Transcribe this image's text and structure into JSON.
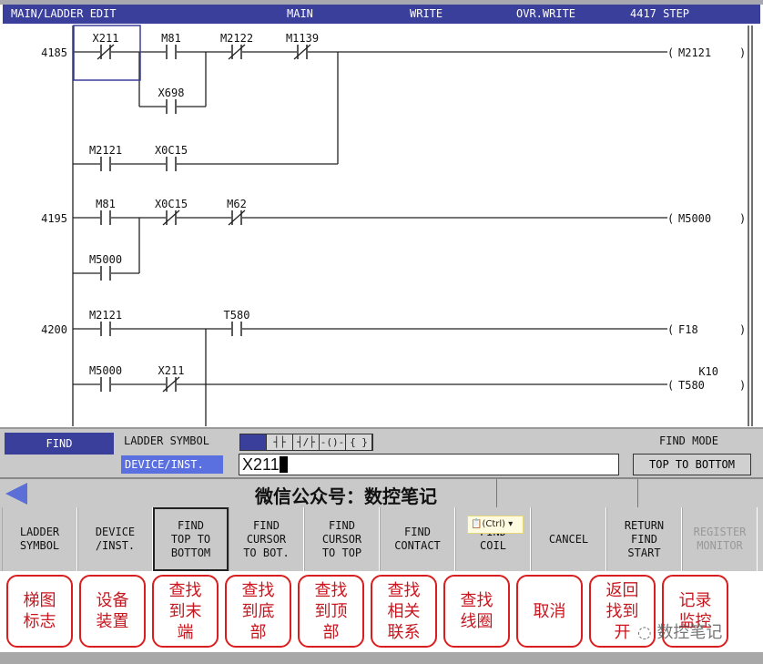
{
  "header": {
    "mode": "MAIN/LADDER EDIT",
    "program": "MAIN",
    "write": "WRITE",
    "overwrite": "OVR.WRITE",
    "steps": "4417 STEP"
  },
  "ladder": {
    "step_numbers": [
      "4185",
      "4195",
      "4200"
    ],
    "contacts": [
      {
        "label": "X211",
        "type": "NC"
      },
      {
        "label": "M81",
        "type": "NO"
      },
      {
        "label": "M2122",
        "type": "NC"
      },
      {
        "label": "M1139",
        "type": "NC"
      },
      {
        "label": "X698",
        "type": "NO"
      },
      {
        "label": "M2121",
        "type": "NO"
      },
      {
        "label": "X0C15",
        "type": "NO"
      },
      {
        "label": "M81",
        "type": "NO"
      },
      {
        "label": "X0C15",
        "type": "NC"
      },
      {
        "label": "M62",
        "type": "NC"
      },
      {
        "label": "M5000",
        "type": "NO"
      },
      {
        "label": "M2121",
        "type": "NO"
      },
      {
        "label": "T580",
        "type": "NO"
      },
      {
        "label": "M5000",
        "type": "NO"
      },
      {
        "label": "X211",
        "type": "NC"
      }
    ],
    "coils": [
      {
        "label": "M2121"
      },
      {
        "label": "M5000"
      },
      {
        "label": "F18"
      },
      {
        "label": "T580",
        "setting": "K10"
      }
    ],
    "cursor_on": "X211"
  },
  "find": {
    "title": "FIND",
    "ladder_symbol_label": "LADDER SYMBOL",
    "device_label": "DEVICE/INST.",
    "symbols": [
      "",
      "┤├",
      "┤/├",
      "-()-",
      "{ }"
    ],
    "input_value": "X211",
    "mode_label": "FIND MODE",
    "mode_value": "TOP TO BOTTOM"
  },
  "message": "微信公众号：数控笔记",
  "softkeys": [
    {
      "label": "LADDER\nSYMBOL"
    },
    {
      "label": "DEVICE\n/INST."
    },
    {
      "label": "FIND\nTOP TO\nBOTTOM",
      "selected": true
    },
    {
      "label": "FIND\nCURSOR\nTO BOT."
    },
    {
      "label": "FIND\nCURSOR\nTO TOP"
    },
    {
      "label": "FIND\nCONTACT"
    },
    {
      "label": "FIND\nCOIL"
    },
    {
      "label": "CANCEL"
    },
    {
      "label": "RETURN\nFIND\nSTART"
    },
    {
      "label": "REGISTER\nMONITOR",
      "disabled": true
    }
  ],
  "paste_tooltip": "(Ctrl) ▾",
  "translations": [
    "梯图\n标志",
    "设备\n装置",
    "查找\n到末\n端",
    "查找\n到底\n部",
    "查找\n到顶\n部",
    "查找\n相关\n联系",
    "查找\n线圈",
    "取消",
    "返回\n找到\n开",
    "记录\n监控"
  ],
  "watermark": "数控笔记",
  "colors": {
    "header_bg": "#3a3f9b",
    "highlight": "#5a6fe0",
    "annotation_red": "#d81e1e",
    "panel_gray": "#c9c9c9"
  }
}
